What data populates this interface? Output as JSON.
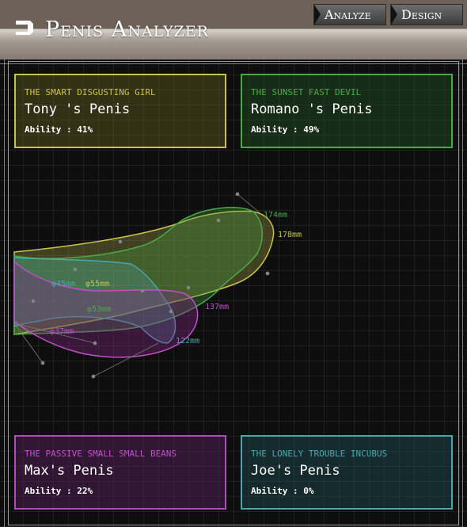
{
  "app": {
    "title": "Penis Analyzer",
    "logo_icon": "arrow-logo-icon"
  },
  "nav": {
    "tabs": [
      {
        "label": "Analyze",
        "icon": "arrow-tab-icon"
      },
      {
        "label": "Design",
        "icon": "arrow-tab-icon"
      }
    ]
  },
  "cards": [
    {
      "subtitle": "The smart disgusting girl",
      "title": "Tony 's Penis",
      "ability": "Ability : 41%",
      "color": "#c6c24e"
    },
    {
      "subtitle": "The sunset fast devil",
      "title": "Romano 's Penis",
      "ability": "Ability : 49%",
      "color": "#4aa94a"
    },
    {
      "subtitle": "The passive small small beans",
      "title": "Max's Penis",
      "ability": "Ability : 22%",
      "color": "#c150c8"
    },
    {
      "subtitle": "The lonely trouble incubus",
      "title": "Joe's Penis",
      "ability": "Ability : 0%",
      "color": "#4aa8ad"
    }
  ],
  "chart": {
    "labels": {
      "green_length": "174mm",
      "yellow_length": "178mm",
      "magenta_length": "137mm",
      "cyan_length": "122mm",
      "cyan_diameter": "φ45mm",
      "yellow_diameter": "φ55mm",
      "green_diameter": "φ53mm",
      "magenta_diameter": "φ37mm"
    },
    "colors": {
      "yellow": "#c6c24e",
      "green": "#4aa94a",
      "magenta": "#c150c8",
      "cyan": "#4aa8ad"
    }
  }
}
